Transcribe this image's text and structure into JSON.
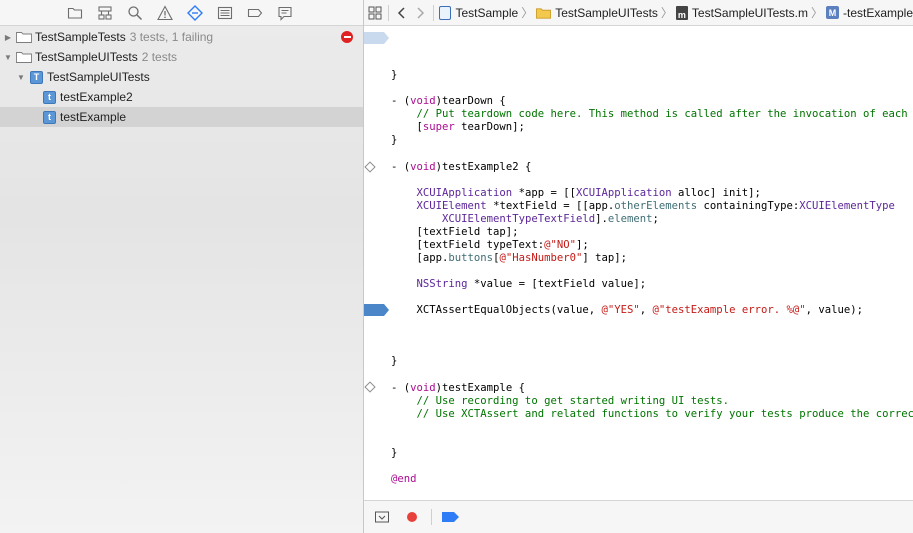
{
  "navigator": {
    "toolbar_icons": [
      "folder-icon",
      "hierarchy-icon",
      "search-icon",
      "warning-icon",
      "test-icon",
      "debug-icon",
      "breakpoint-icon",
      "report-icon"
    ],
    "tree": [
      {
        "label": "TestSampleTests",
        "sub": "3 tests, 1 failing",
        "status": "failing"
      },
      {
        "label": "TestSampleUITests",
        "sub": "2 tests"
      },
      {
        "label": "TestSampleUITests",
        "sub": ""
      },
      {
        "label": "testExample2",
        "sub": ""
      },
      {
        "label": "testExample",
        "sub": "",
        "selected": true
      }
    ]
  },
  "jumpbar": {
    "crumbs": [
      "TestSample",
      "TestSampleUITests",
      "TestSampleUITests.m",
      "-testExample"
    ]
  },
  "editor": {
    "lines": {
      "l1": "}",
      "l2a": "- (",
      "l2b": "void",
      "l2c": ")tearDown {",
      "l3": "    // Put teardown code here. This method is called after the invocation of each test method in the class.",
      "l4a": "    [",
      "l4b": "super",
      "l4c": " tearDown];",
      "l5": "}",
      "l6a": "- (",
      "l6b": "void",
      "l6c": ")testExample2 {",
      "l7a": "    ",
      "l7b": "XCUIApplication",
      "l7c": " *app = [[",
      "l7d": "XCUIApplication",
      "l7e": " alloc] init];",
      "l8a": "    ",
      "l8b": "XCUIElement",
      "l8c": " *textField = [[app.",
      "l8d": "otherElements",
      "l8e": " containingType:",
      "l8f": "XCUIElementType",
      "l9a": "        ",
      "l9b": "XCUIElementTypeTextField",
      "l9c": "].",
      "l9d": "element",
      "l9e": ";",
      "l10": "    [textField tap];",
      "l11a": "    [textField typeText:",
      "l11b": "@\"NO\"",
      "l11c": "];",
      "l12a": "    [app.",
      "l12b": "buttons",
      "l12c": "[",
      "l12d": "@\"HasNumber0\"",
      "l12e": "] tap];",
      "l13a": "    ",
      "l13b": "NSString",
      "l13c": " *value = [textField value];",
      "l14a": "    XCTAssertEqualObjects(value, ",
      "l14b": "@\"YES\"",
      "l14c": ", ",
      "l14d": "@\"testExample error. %@\"",
      "l14e": ", value);",
      "l15": "}",
      "l16a": "- (",
      "l16b": "void",
      "l16c": ")testExample {",
      "l17": "    // Use recording to get started writing UI tests.",
      "l18": "    // Use XCTAssert and related functions to verify your tests produce the correct results.",
      "l19": "}",
      "l20": "@end"
    }
  },
  "debugbar": {
    "icons": [
      "hide-console-icon",
      "breakpoint-record-icon",
      "breakpoints-active-icon"
    ]
  },
  "colors": {
    "accent": "#2e7cf6",
    "fail": "#e02222",
    "keyword": "#aa0d91",
    "class": "#5c2699",
    "comment": "#007400",
    "string": "#c41a16",
    "method": "#3f6e74",
    "breakpoint": "#4a86c8"
  }
}
